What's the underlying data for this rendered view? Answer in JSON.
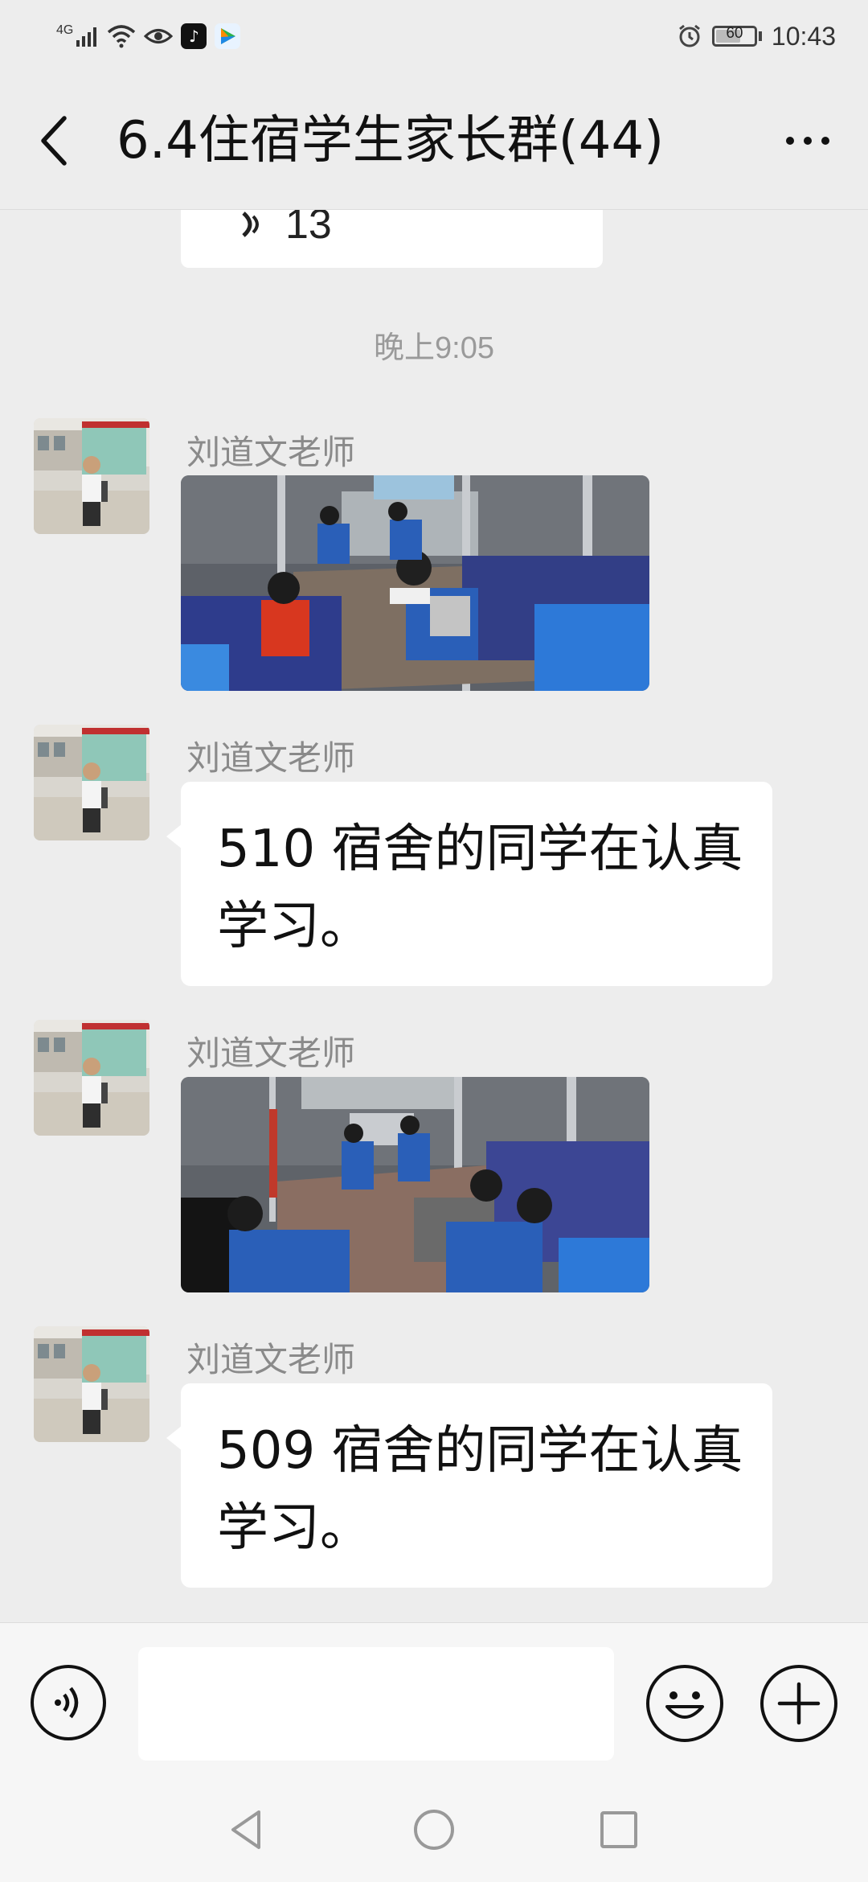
{
  "status_bar": {
    "network": "4G",
    "time": "10:43",
    "battery_level": "60"
  },
  "header": {
    "title": "6.4住宿学生家长群(44)",
    "back_icon": "chevron-left-icon",
    "more_icon": "more-dots-icon"
  },
  "chat": {
    "previous_voice_duration": "13",
    "timestamp": "晚上9:05",
    "messages": [
      {
        "sender": "刘道文老师",
        "type": "image"
      },
      {
        "sender": "刘道文老师",
        "type": "text",
        "text": "510 宿舍的同学在认真学习。"
      },
      {
        "sender": "刘道文老师",
        "type": "image"
      },
      {
        "sender": "刘道文老师",
        "type": "text",
        "text": "509 宿舍的同学在认真学习。"
      }
    ]
  },
  "input_bar": {
    "voice_icon": "voice-input-icon",
    "input_value": "",
    "emoji_icon": "emoji-icon",
    "plus_icon": "plus-icon"
  },
  "nav_bar": {
    "back_icon": "nav-back-icon",
    "home_icon": "nav-home-icon",
    "recents_icon": "nav-recents-icon"
  }
}
